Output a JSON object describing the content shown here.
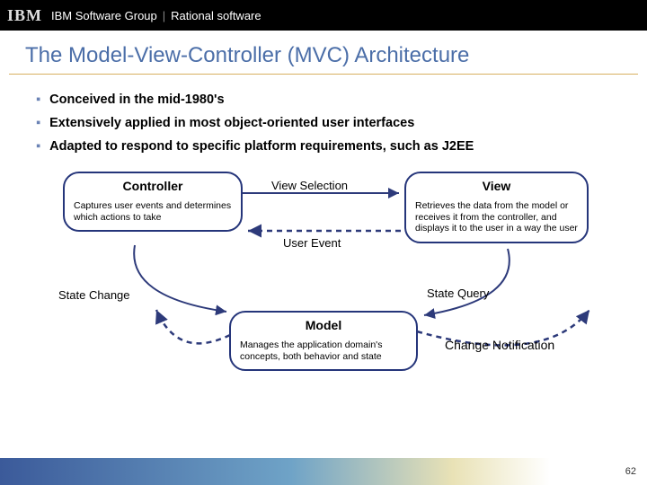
{
  "header": {
    "logo_text": "IBM",
    "group": "IBM Software Group",
    "product": "Rational software"
  },
  "title": "The Model-View-Controller (MVC) Architecture",
  "bullets": [
    "Conceived in the mid-1980's",
    "Extensively applied in most object-oriented user interfaces",
    "Adapted to respond to specific platform requirements, such as J2EE"
  ],
  "nodes": {
    "controller": {
      "title": "Controller",
      "desc": "Captures user events and determines which actions to take"
    },
    "view": {
      "title": "View",
      "desc": "Retrieves the data from the model or receives it from the controller, and displays it to the user in a way the user"
    },
    "model": {
      "title": "Model",
      "desc": "Manages the application domain's concepts, both behavior and state"
    }
  },
  "labels": {
    "view_selection": "View Selection",
    "user_event": "User Event",
    "state_change": "State Change",
    "state_query": "State Query",
    "change_notification": "Change Notification"
  },
  "slide_number": "62"
}
